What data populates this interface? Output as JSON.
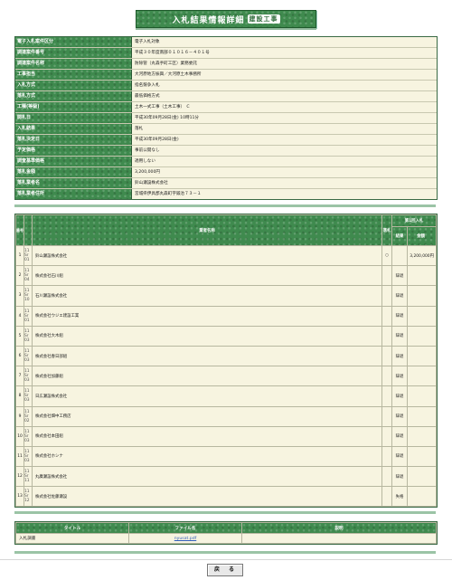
{
  "title": "入札結果情報詳細",
  "title_tag": "建設工事",
  "info": [
    {
      "label": "電子入札案件区分",
      "value": "電子入札対象"
    },
    {
      "label": "調達案件番号",
      "value": "平成３０年度南部０１０１６－４０１号"
    },
    {
      "label": "調達案件名称",
      "value": "防除管（丸森手町工区）業務委託"
    },
    {
      "label": "工事担当",
      "value": "大河原地方振興／大河原土木事務所"
    },
    {
      "label": "入札方式",
      "value": "指名競争入札"
    },
    {
      "label": "落札方式",
      "value": "最低価格方式"
    },
    {
      "label": "工種(等級)",
      "value": "土木一式工事（土木工事）　C"
    },
    {
      "label": "開札日",
      "value": "平成30年09月28日(金) 10時11分"
    },
    {
      "label": "入札結果",
      "value": "落札"
    },
    {
      "label": "落札決定日",
      "value": "平成30年09月28日(金)"
    },
    {
      "label": "予定価格",
      "value": "事前公開なし"
    },
    {
      "label": "調査基準価格",
      "value": "適用しない"
    },
    {
      "label": "落札金額",
      "value": "3,200,000円"
    },
    {
      "label": "落札業者名",
      "value": "鈴山瀬設株式会社"
    },
    {
      "label": "落札業者住所",
      "value": "宮城県伊具郡丸森町字鍛冶７３－１"
    }
  ],
  "results": {
    "col_no": "番号",
    "col_name": "業者名称",
    "col_flag": "落札",
    "col_round": "第1回入札",
    "col_status": "結果",
    "col_amount": "金額",
    "rows": [
      {
        "no": "1",
        "code": "11 Sr 01",
        "name": "鈴山瀬設株式会社",
        "flag": "○",
        "status": "",
        "amount": "3,200,000円"
      },
      {
        "no": "2",
        "code": "11 Sr 04",
        "name": "株式会社石川組",
        "flag": "",
        "status": "辞退",
        "amount": ""
      },
      {
        "no": "3",
        "code": "11 Sr 10",
        "name": "石川瀬設株式会社",
        "flag": "",
        "status": "辞退",
        "amount": ""
      },
      {
        "no": "4",
        "code": "11 Sr 01",
        "name": "株式会社ウジエ建設工業",
        "flag": "",
        "status": "辞退",
        "amount": ""
      },
      {
        "no": "5",
        "code": "11 Sr 03",
        "name": "株式会社大木組",
        "flag": "",
        "status": "辞退",
        "amount": ""
      },
      {
        "no": "6",
        "code": "11 Sr 03",
        "name": "株式会社春日部組",
        "flag": "",
        "status": "辞退",
        "amount": ""
      },
      {
        "no": "7",
        "code": "11 Sr 03",
        "name": "株式会社加藤組",
        "flag": "",
        "status": "辞退",
        "amount": ""
      },
      {
        "no": "8",
        "code": "11 Sr 03",
        "name": "日広瀬設株式会社",
        "flag": "",
        "status": "辞退",
        "amount": ""
      },
      {
        "no": "9",
        "code": "11 Sr 02",
        "name": "株式会社畑中工務店",
        "flag": "",
        "status": "辞退",
        "amount": ""
      },
      {
        "no": "10",
        "code": "11 Sr 03",
        "name": "株式会社本田組",
        "flag": "",
        "status": "辞退",
        "amount": ""
      },
      {
        "no": "11",
        "code": "11 Sr 03",
        "name": "株式会社ホシナ",
        "flag": "",
        "status": "辞退",
        "amount": ""
      },
      {
        "no": "12",
        "code": "11 Sr 11",
        "name": "丸廣瀬設株式会社",
        "flag": "",
        "status": "辞退",
        "amount": ""
      },
      {
        "no": "13",
        "code": "11 Sr 12",
        "name": "株式会社佐藤瀬設",
        "flag": "",
        "status": "失格",
        "amount": ""
      }
    ]
  },
  "files": {
    "col_title": "タイトル",
    "col_file": "ファイル名",
    "col_desc": "説明",
    "rows": [
      {
        "title": "入札調書",
        "file": "nyusat.pdf",
        "desc": ""
      }
    ]
  },
  "back_label": "戻　る"
}
